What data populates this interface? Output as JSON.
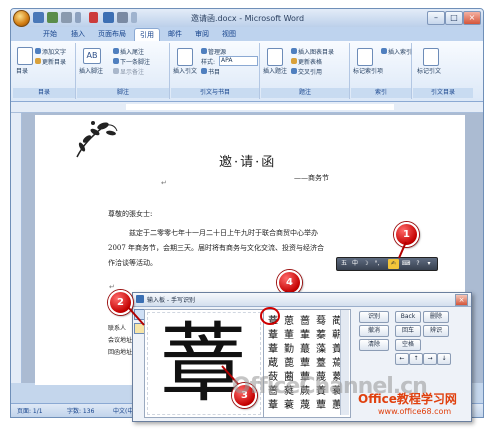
{
  "window": {
    "title": "邀请函.docx - Microsoft Word",
    "controls": [
      "–",
      "□",
      "×"
    ]
  },
  "tabs": [
    {
      "label": "开始",
      "active": false
    },
    {
      "label": "插入",
      "active": false
    },
    {
      "label": "页面布局",
      "active": false
    },
    {
      "label": "引用",
      "active": true
    },
    {
      "label": "邮件",
      "active": false
    },
    {
      "label": "审阅",
      "active": false
    },
    {
      "label": "视图",
      "active": false
    }
  ],
  "ribbon": {
    "toc": {
      "big_button": "目录",
      "add_text": "添加文字",
      "update_toc": "更新目录",
      "label": "目录"
    },
    "footnotes": {
      "insert_footnote": "插入脚注",
      "insert_endnote": "插入尾注",
      "next_footnote": "下一条脚注",
      "show_notes": "显示备注",
      "label": "脚注"
    },
    "citations": {
      "insert_citation": "插入引文",
      "manage_sources": "管理源",
      "style_label": "样式:",
      "style_value": "APA",
      "bibliography": "书目",
      "label": "引文与书目"
    },
    "captions": {
      "insert_caption": "插入题注",
      "insert_table_of_figures": "插入图表目录",
      "update_table": "更新表格",
      "cross_reference": "交叉引用",
      "label": "题注"
    },
    "index": {
      "mark_entry": "标记索引项",
      "insert_index": "插入索引",
      "label": "索引"
    },
    "toa": {
      "mark_citation": "标记引文",
      "label": "引文目录"
    }
  },
  "document": {
    "title": "邀·请·函",
    "subtitle": "——商务节",
    "salutation": "尊敬的張女士:",
    "body_line1": "兹定于二零零七年十一月二十日上午九时于联合商贸中心举办",
    "body_line2": "2007 年商务节，会期三天。届时将有商务与文化交流、投资与经济合",
    "body_line3": "作洽谈等活动。",
    "fragment1": "联系人",
    "fragment2": "会议地址",
    "fragment3": "回函地址",
    "para_mark": "↵"
  },
  "statusbar": {
    "page": "页面: 1/1",
    "words": "字数: 136",
    "language": "中文(中国)"
  },
  "ime_toolbar": {
    "items": [
      "五",
      "中",
      "☽",
      "°,",
      "✍",
      "⌨",
      "?",
      "▾"
    ]
  },
  "handwriting_pad": {
    "title": "输入板 - 手写识别",
    "written_char": "蔁",
    "candidates": [
      [
        "蔁",
        "葸",
        "蔷",
        "蓦",
        "蔺"
      ],
      [
        "蔁",
        "董",
        "葷",
        "蓁",
        "蕲"
      ],
      [
        "蔁",
        "勤",
        "蕞",
        "藻",
        "蔶"
      ],
      [
        "蔵",
        "蓖",
        "蕈",
        "薹",
        "蔫"
      ],
      [
        "蔹",
        "蔨",
        "蕈",
        "蔑",
        "蔂"
      ],
      [
        "蔷",
        "蕤",
        "蕨",
        "蔶",
        "蓑"
      ],
      [
        "蔁",
        "蓑",
        "蔑",
        "蕈",
        "蕙"
      ]
    ],
    "buttons": {
      "recognize": "识别",
      "backspace": "Back",
      "delete": "删除",
      "cancel": "撤消",
      "enter": "回车",
      "clear": "清除",
      "space": "空格",
      "fixed": "辨识",
      "left": "←",
      "up": "↑",
      "right": "→",
      "down": "↓"
    }
  },
  "callouts": [
    "1",
    "2",
    "3",
    "4"
  ],
  "watermark": {
    "main": "OfficeChannel.cn",
    "brand": "Office教程学习网",
    "url": "www.office68.com"
  },
  "colors": {
    "callout_red": "#c40000",
    "ribbon_blue": "#c4d6ec",
    "accent_text": "#15428b"
  }
}
